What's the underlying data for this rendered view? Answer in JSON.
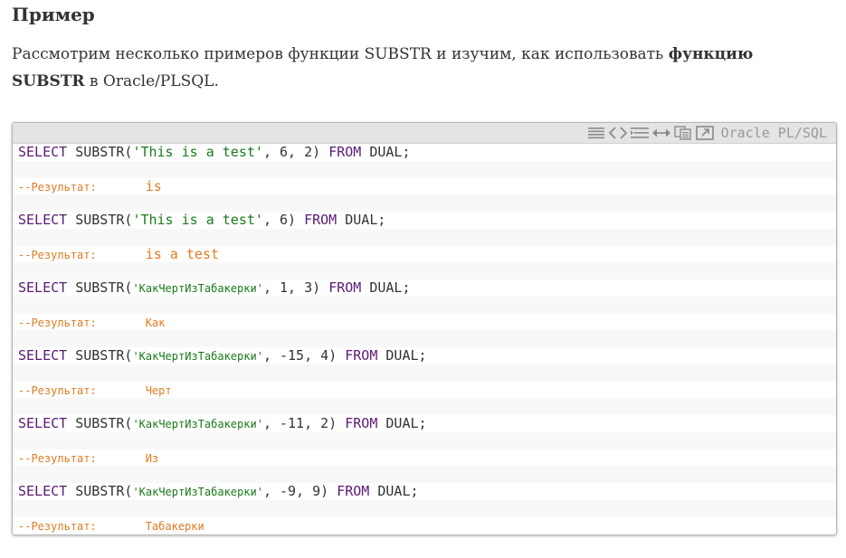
{
  "section": {
    "heading": "Пример",
    "intro_text": "Рассмотрим несколько примеров функции SUBSTR и изучим, как использовать ",
    "intro_bold": "функцию SUBSTR",
    "intro_tail": " в Oracle/PLSQL."
  },
  "code_block": {
    "language_label": "Oracle PL/SQL",
    "toolbar_icons": [
      "view-source-icon",
      "code-icon",
      "wrap-lines-icon",
      "expand-icon",
      "copy-icon",
      "popup-icon"
    ],
    "colors": {
      "keyword": "#5c1a73",
      "string": "#1a7a1a",
      "comment": "#e07b21",
      "text": "#333333",
      "toolbar": "#e4e4e4"
    },
    "syntax": {
      "select": "SELECT",
      "func": "SUBSTR",
      "from": "FROM",
      "table": "DUAL;",
      "comment_label": "--Результат:"
    },
    "examples": [
      {
        "string": "'This is a test'",
        "args": ", 6, 2) ",
        "result": "is"
      },
      {
        "string": "'This is a test'",
        "args": ", 6) ",
        "result": "is a test"
      },
      {
        "string": "'КакЧертИзТабакерки'",
        "args": ", 1, 3) ",
        "result": "Как"
      },
      {
        "string": "'КакЧертИзТабакерки'",
        "args": ", -15, 4) ",
        "result": "Черт"
      },
      {
        "string": "'КакЧертИзТабакерки'",
        "args": ", -11, 2) ",
        "result": "Из"
      },
      {
        "string": "'КакЧертИзТабакерки'",
        "args": ", -9, 9) ",
        "result": "Табакерки"
      }
    ]
  }
}
